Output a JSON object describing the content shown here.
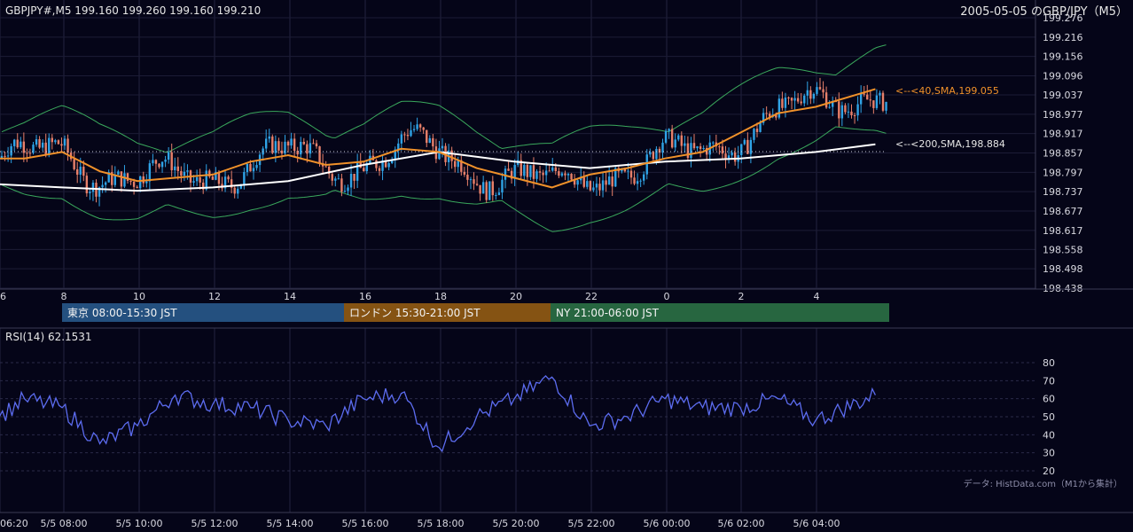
{
  "header": {
    "symbol_line": "GBPJPY#,M5 199.160 199.260 199.160 199.210",
    "title_right": "2005-05-05 のGBP/JPY（M5）"
  },
  "colors": {
    "background": "#050518",
    "grid": "#23233f",
    "candle_up": "#2fa3e6",
    "candle_down": "#e8806a",
    "bollinger": "#3aa85c",
    "sma40": "#f0912a",
    "sma200": "#ffffff",
    "rsi_line": "#5c6cf0",
    "session_tokyo": "#24507f",
    "session_london": "#855313",
    "session_ny": "#276640"
  },
  "price_axis": {
    "ticks": [
      "199.276",
      "199.216",
      "199.156",
      "199.096",
      "199.037",
      "198.977",
      "198.917",
      "198.857",
      "198.797",
      "198.737",
      "198.677",
      "198.617",
      "198.558",
      "198.498",
      "198.438"
    ]
  },
  "hour_axis": {
    "ticks": [
      "6",
      "8",
      "10",
      "12",
      "14",
      "16",
      "18",
      "20",
      "22",
      "0",
      "2",
      "4"
    ]
  },
  "sma_labels": {
    "sma40": "<--<40,SMA,199.055",
    "sma200": "<--<200,SMA,198.884"
  },
  "sessions": [
    {
      "label": "東京 08:00-15:30 JST"
    },
    {
      "label": "ロンドン 15:30-21:00 JST"
    },
    {
      "label": "NY 21:00-06:00 JST"
    }
  ],
  "rsi": {
    "label": "RSI(14) 62.1531",
    "ticks": [
      "80",
      "70",
      "60",
      "50",
      "40",
      "30",
      "20"
    ]
  },
  "source_note": "データ: HistData.com（M1から集計）",
  "time_axis": {
    "ticks": [
      "06:20",
      "5/5 08:00",
      "5/5 10:00",
      "5/5 12:00",
      "5/5 14:00",
      "5/5 16:00",
      "5/5 18:00",
      "5/5 20:00",
      "5/5 22:00",
      "5/6 00:00",
      "5/6 02:00",
      "5/6 04:00"
    ]
  },
  "chart_data": [
    {
      "type": "line",
      "title": "GBPJPY#,M5",
      "ylim": [
        198.438,
        199.276
      ],
      "series": [
        {
          "name": "40,SMA",
          "x": [
            "06:20",
            "07:00",
            "08:00",
            "09:00",
            "10:00",
            "11:00",
            "12:00",
            "13:00",
            "14:00",
            "15:00",
            "16:00",
            "17:00",
            "18:00",
            "19:00",
            "20:00",
            "21:00",
            "22:00",
            "23:00",
            "00:00",
            "01:00",
            "02:00",
            "03:00",
            "04:00",
            "05:35"
          ],
          "values": [
            198.84,
            198.84,
            198.86,
            198.8,
            198.77,
            198.78,
            198.79,
            198.83,
            198.85,
            198.82,
            198.83,
            198.87,
            198.86,
            198.81,
            198.78,
            198.75,
            198.79,
            198.81,
            198.84,
            198.86,
            198.92,
            198.98,
            199.0,
            199.055
          ]
        },
        {
          "name": "200,SMA",
          "x": [
            "06:20",
            "08:00",
            "10:00",
            "12:00",
            "14:00",
            "16:00",
            "18:00",
            "20:00",
            "22:00",
            "00:00",
            "02:00",
            "04:00",
            "05:35"
          ],
          "values": [
            198.76,
            198.75,
            198.74,
            198.75,
            198.77,
            198.82,
            198.86,
            198.83,
            198.81,
            198.83,
            198.84,
            198.86,
            198.884
          ]
        }
      ]
    },
    {
      "type": "line",
      "title": "RSI(14) 62.1531",
      "ylim": [
        20,
        80
      ],
      "series": [
        {
          "name": "RSI(14)",
          "x": [
            "06:20",
            "07:00",
            "08:00",
            "09:00",
            "10:00",
            "11:00",
            "12:00",
            "13:00",
            "14:00",
            "15:00",
            "16:00",
            "17:00",
            "18:00",
            "19:00",
            "20:00",
            "21:00",
            "22:00",
            "23:00",
            "00:00",
            "01:00",
            "02:00",
            "03:00",
            "04:00",
            "05:35"
          ],
          "values": [
            50,
            60,
            55,
            35,
            45,
            62,
            57,
            55,
            48,
            45,
            60,
            63,
            33,
            50,
            60,
            72,
            45,
            50,
            60,
            55,
            55,
            60,
            48,
            62
          ]
        }
      ]
    }
  ]
}
